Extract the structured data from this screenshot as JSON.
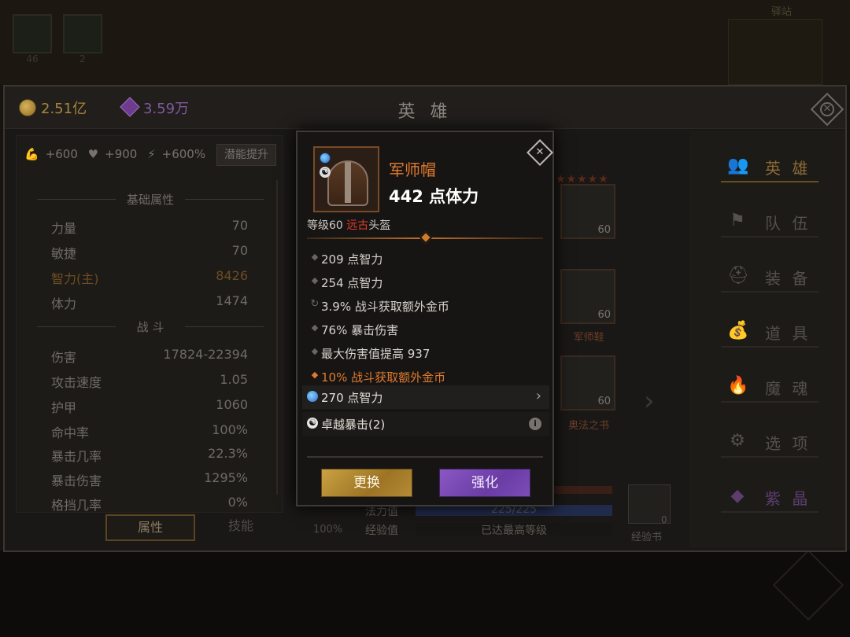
{
  "background": {
    "skill_counts": [
      "46",
      "2"
    ],
    "map_label": "驿站"
  },
  "header": {
    "gold": "2.51亿",
    "gems": "3.59万",
    "title": "英 雄"
  },
  "left": {
    "boosts": [
      "+600",
      "+900",
      "+600%"
    ],
    "boost_button": "潜能提升",
    "section_basic": "基础属性",
    "basic": [
      {
        "label": "力量",
        "value": "70"
      },
      {
        "label": "敏捷",
        "value": "70"
      },
      {
        "label": "智力(主)",
        "value": "8426"
      },
      {
        "label": "体力",
        "value": "1474"
      }
    ],
    "section_combat": "战 斗",
    "combat": [
      {
        "label": "伤害",
        "value": "17824-22394"
      },
      {
        "label": "攻击速度",
        "value": "1.05"
      },
      {
        "label": "护甲",
        "value": "1060"
      },
      {
        "label": "命中率",
        "value": "100%"
      },
      {
        "label": "暴击几率",
        "value": "22.3%"
      },
      {
        "label": "暴击伤害",
        "value": "1295%"
      },
      {
        "label": "格挡几率",
        "value": "0%"
      }
    ],
    "tab_attr": "属性",
    "tab_skill": "技能"
  },
  "center": {
    "slot_levels": [
      "60",
      "60",
      "60"
    ],
    "slot_names": [
      "军师鞋",
      "奥法之书"
    ],
    "extra_level": "60",
    "hero_pct": "100%",
    "mana_label": "法力值",
    "mana_text": "225/225",
    "xp_label": "经验值",
    "xp_text": "已达最高等级",
    "xp_book_count": "0",
    "xp_book_label": "经验书",
    "hero_id": "f4ba0856-e674-4fc1-a916"
  },
  "nav": [
    {
      "label": "英 雄",
      "icon": "hero-icon",
      "glyph": "👥"
    },
    {
      "label": "队 伍",
      "icon": "flag-icon",
      "glyph": "⚑"
    },
    {
      "label": "装 备",
      "icon": "helmet-icon",
      "glyph": "⛑"
    },
    {
      "label": "道 具",
      "icon": "bag-icon",
      "glyph": "💰"
    },
    {
      "label": "魔 魂",
      "icon": "flame-icon",
      "glyph": "🔥"
    },
    {
      "label": "选 项",
      "icon": "gear-icon",
      "glyph": "⚙"
    },
    {
      "label": "紫 晶",
      "icon": "gem-icon",
      "glyph": "◆"
    }
  ],
  "tooltip": {
    "item_name": "军师帽",
    "main_stat": "442 点体力",
    "level_prefix": "等级60 ",
    "rarity": "远古",
    "item_type": "头盔",
    "affixes": [
      {
        "bullet": "◆",
        "text": "209 点智力",
        "style": "normal"
      },
      {
        "bullet": "◆",
        "text": "254 点智力",
        "style": "normal"
      },
      {
        "bullet": "↻",
        "text": "3.9% 战斗获取额外金币",
        "style": "cycle"
      },
      {
        "bullet": "◆",
        "text": "76% 暴击伤害",
        "style": "normal"
      },
      {
        "bullet": "◆",
        "text": "最大伤害值提高 937",
        "style": "normal"
      },
      {
        "bullet": "◆",
        "text": "10% 战斗获取额外金币",
        "style": "gold"
      }
    ],
    "socket_text": "270 点智力",
    "set_text": "卓越暴击(2)",
    "button_swap": "更换",
    "button_upgrade": "强化"
  },
  "colors": {
    "rarity_red": "#e23a2a",
    "item_orange": "#e07a2e",
    "swap_gold": "#b48c36",
    "upgrade_purple": "#7c4cb8"
  }
}
